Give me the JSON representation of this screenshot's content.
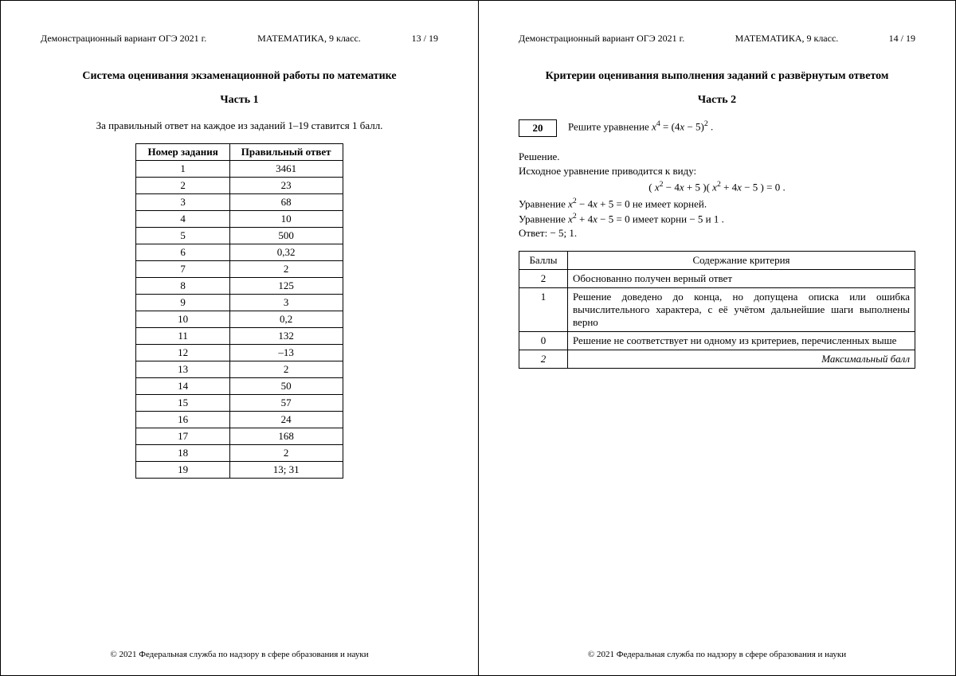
{
  "left": {
    "header": {
      "left": "Демонстрационный вариант ОГЭ 2021 г.",
      "mid": "МАТЕМАТИКА, 9 класс.",
      "right": "13 / 19"
    },
    "title": "Система оценивания экзаменационной работы по математике",
    "part": "Часть 1",
    "intro": "За правильный ответ на каждое из заданий 1–19 ставится 1 балл.",
    "table": {
      "head_num": "Номер задания",
      "head_ans": "Правильный ответ",
      "rows": [
        {
          "n": "1",
          "a": "3461"
        },
        {
          "n": "2",
          "a": "23"
        },
        {
          "n": "3",
          "a": "68"
        },
        {
          "n": "4",
          "a": "10"
        },
        {
          "n": "5",
          "a": "500"
        },
        {
          "n": "6",
          "a": "0,32"
        },
        {
          "n": "7",
          "a": "2"
        },
        {
          "n": "8",
          "a": "125"
        },
        {
          "n": "9",
          "a": "3"
        },
        {
          "n": "10",
          "a": "0,2"
        },
        {
          "n": "11",
          "a": "132"
        },
        {
          "n": "12",
          "a": "–13"
        },
        {
          "n": "13",
          "a": "2"
        },
        {
          "n": "14",
          "a": "50"
        },
        {
          "n": "15",
          "a": "57"
        },
        {
          "n": "16",
          "a": "24"
        },
        {
          "n": "17",
          "a": "168"
        },
        {
          "n": "18",
          "a": "2"
        },
        {
          "n": "19",
          "a": "13; 31"
        }
      ]
    },
    "footer": "© 2021 Федеральная служба по надзору в сфере образования и науки"
  },
  "right": {
    "header": {
      "left": "Демонстрационный вариант ОГЭ 2021 г.",
      "mid": "МАТЕМАТИКА, 9 класс.",
      "right": "14 / 19"
    },
    "title": "Критерии оценивания выполнения заданий с развёрнутым ответом",
    "part": "Часть 2",
    "task": {
      "num": "20",
      "prompt_pre": "Решите уравнение ",
      "prompt_post": " ."
    },
    "solution": {
      "label": "Решение.",
      "line1": "Исходное уравнение приводится к виду:",
      "line2_pre": "Уравнение ",
      "line2_post": " не имеет корней.",
      "line3_pre": "Уравнение ",
      "line3_post": " имеет корни − 5 и 1 .",
      "answer": "Ответ:  − 5; 1."
    },
    "rubric": {
      "head_pts": "Баллы",
      "head_crit": "Содержание критерия",
      "rows": [
        {
          "pts": "2",
          "txt": "Обоснованно получен верный ответ"
        },
        {
          "pts": "1",
          "txt": "Решение доведено до конца, но допущена описка или ошибка вычислительного характера, с её учётом дальнейшие шаги выполнены верно"
        },
        {
          "pts": "0",
          "txt": "Решение не соответствует ни одному из критериев, перечисленных выше"
        }
      ],
      "max_pts": "2",
      "max_label": "Максимальный балл"
    },
    "footer": "© 2021 Федеральная служба по надзору в сфере образования и науки"
  }
}
